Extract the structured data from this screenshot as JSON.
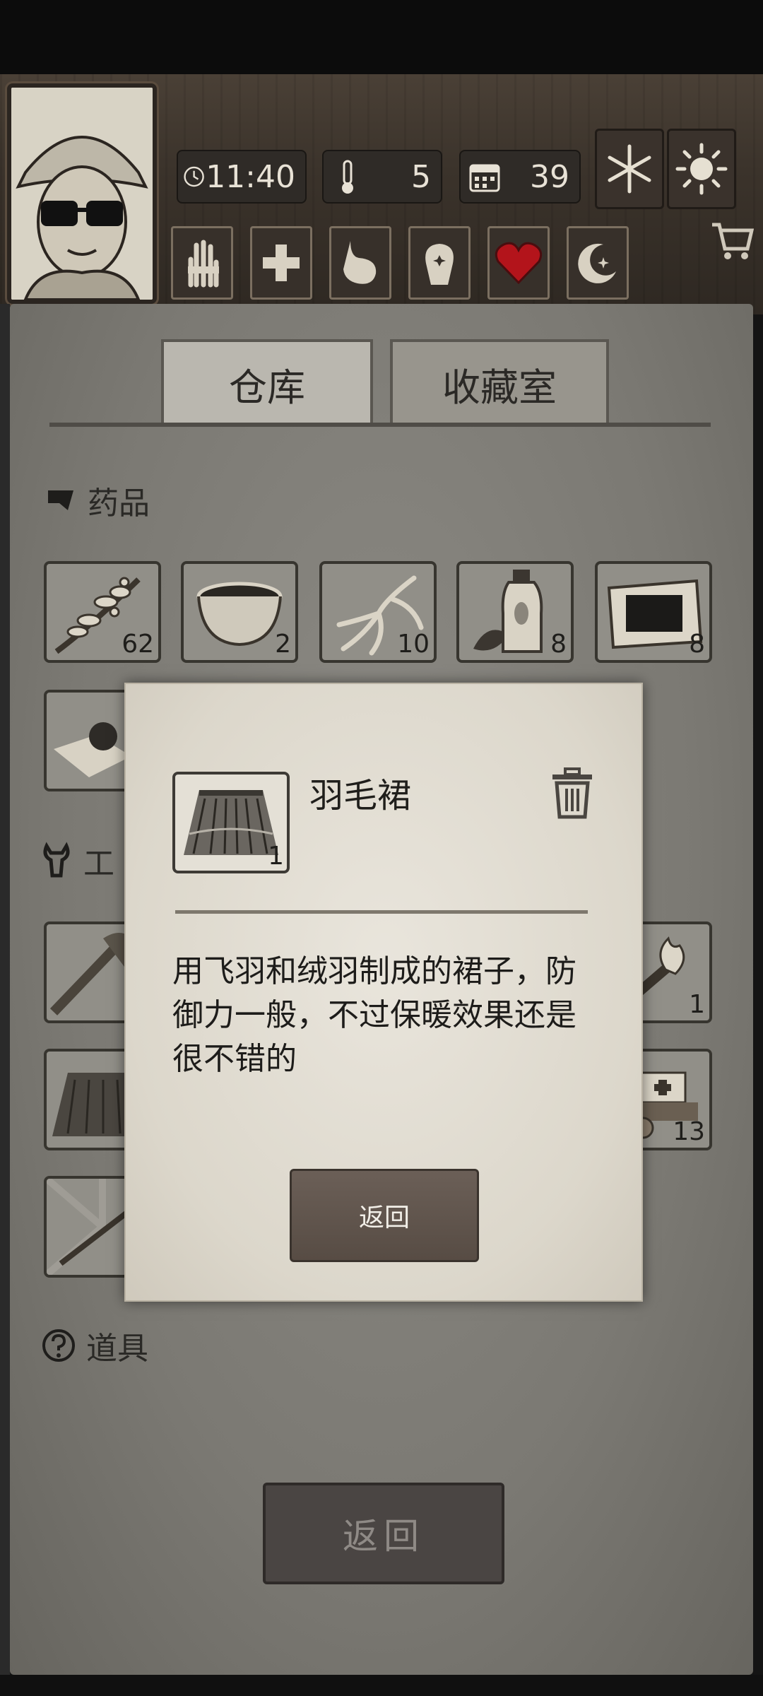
{
  "hud": {
    "time": "11:40",
    "temperature": "5",
    "day": "39",
    "weather_icons": [
      "snowflake-icon",
      "sun-icon"
    ],
    "status_icons": [
      "hand-bandage-icon",
      "health-cross-icon",
      "stomach-icon",
      "head-sparkle-icon",
      "heart-icon",
      "moon-icon"
    ],
    "shop_icon": "cart-icon"
  },
  "tabs": [
    {
      "label": "仓库"
    },
    {
      "label": "收藏室"
    }
  ],
  "sections": {
    "medicine": {
      "title": "药品"
    },
    "tools": {
      "title": "工"
    },
    "props": {
      "title": "道具"
    }
  },
  "medicine_items": [
    {
      "icon": "herb-branch-icon",
      "qty": "62"
    },
    {
      "icon": "bowl-icon",
      "qty": "2"
    },
    {
      "icon": "ginseng-root-icon",
      "qty": "10"
    },
    {
      "icon": "bottle-herb-icon",
      "qty": "8"
    },
    {
      "icon": "plaster-icon",
      "qty": "8"
    }
  ],
  "right_items": [
    {
      "icon": "torch-icon",
      "qty": "1"
    },
    {
      "icon": "first-aid-cart-icon",
      "qty": "13"
    }
  ],
  "dialog": {
    "item_name": "羽毛裙",
    "item_qty": "1",
    "description": "用飞羽和绒羽制成的裙子，防御力一般，不过保暖效果还是很不错的",
    "back_label": "返回"
  },
  "main_back_label": "返回",
  "colors": {
    "heart": "#b3141b",
    "panel": "#7b7973",
    "dialog": "#e2ddd2",
    "button": "#5f544c"
  }
}
